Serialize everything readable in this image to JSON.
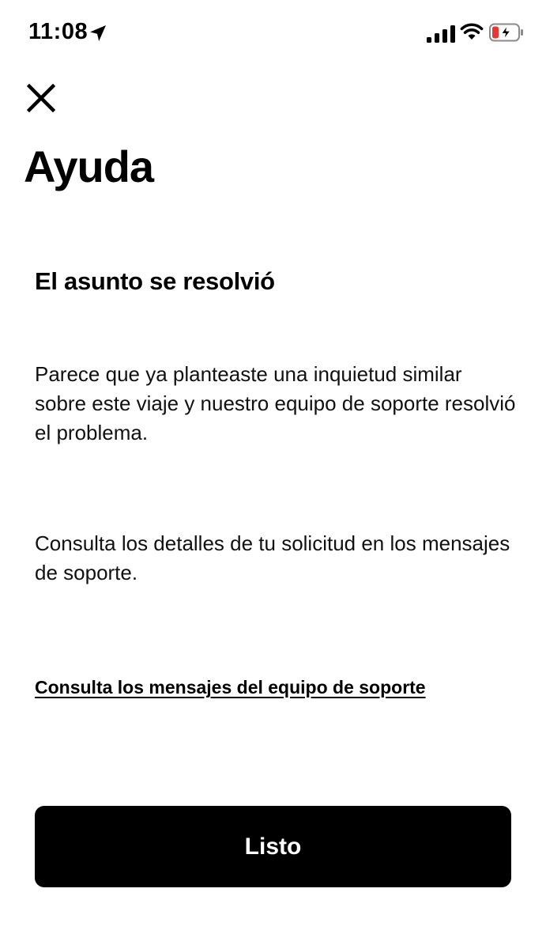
{
  "status_bar": {
    "time": "11:08",
    "icons": [
      "location-arrow-icon",
      "cellular-signal-icon",
      "wifi-icon",
      "battery-charging-icon"
    ],
    "battery_color": "#e53935"
  },
  "header": {
    "close_icon": "close-icon",
    "title": "Ayuda"
  },
  "content": {
    "heading": "El asunto se resolvió",
    "paragraph_1": "Parece que ya planteaste una inquietud similar sobre este viaje y nuestro equipo de soporte resolvió el problema.",
    "paragraph_2": "Consulta los detalles de tu solicitud en los mensajes de soporte.",
    "link_label": "Consulta los mensajes del equipo de soporte"
  },
  "footer": {
    "done_label": "Listo",
    "button_color": "#000000"
  }
}
